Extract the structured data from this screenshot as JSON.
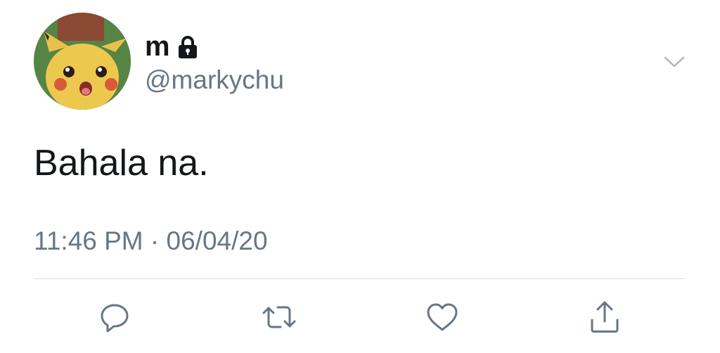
{
  "user": {
    "display_name": "m",
    "handle": "@markychu",
    "avatar_icon": "pikachu-avatar",
    "protected_icon": "lock-icon"
  },
  "tweet": {
    "text": "Bahala na.",
    "time": "11:46 PM",
    "separator": "·",
    "date": "06/04/20"
  },
  "actions": [
    {
      "name": "reply",
      "icon": "reply-icon"
    },
    {
      "name": "retweet",
      "icon": "retweet-icon"
    },
    {
      "name": "like",
      "icon": "heart-icon"
    },
    {
      "name": "share",
      "icon": "share-icon"
    }
  ],
  "colors": {
    "text": "#14171a",
    "secondary": "#657786",
    "icon": "#657786",
    "divider": "#d8dee2"
  }
}
